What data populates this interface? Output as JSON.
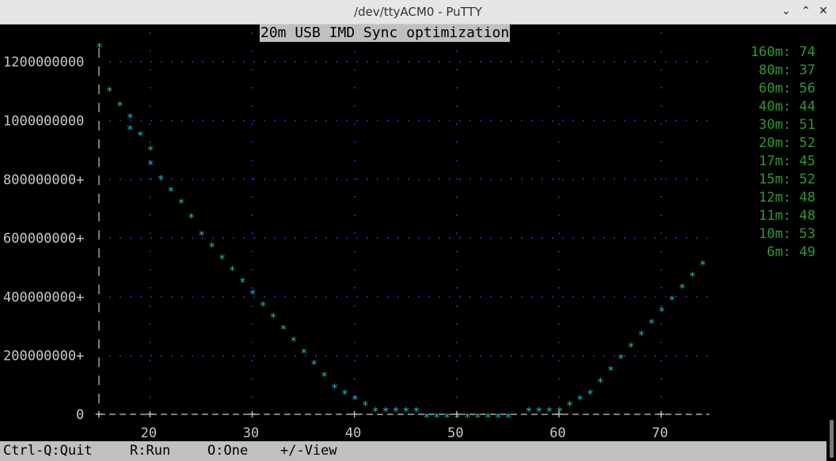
{
  "window": {
    "title": "/dev/ttyACM0 - PuTTY",
    "controls": {
      "minimize": "⌄",
      "maximize": "⌃",
      "close": "✕"
    }
  },
  "terminal": {
    "title": "20m USB IMD Sync optimization",
    "status": [
      {
        "key": "ctrl-q",
        "label": "Ctrl-Q:Quit"
      },
      {
        "key": "r",
        "label": "R:Run"
      },
      {
        "key": "o",
        "label": "O:One"
      },
      {
        "key": "plus-minus",
        "label": "+/-View"
      }
    ],
    "bands": [
      {
        "band": "160m",
        "text": "160m: 74"
      },
      {
        "band": "80m",
        "text": "80m: 37"
      },
      {
        "band": "60m",
        "text": "60m: 56"
      },
      {
        "band": "40m",
        "text": "40m: 44"
      },
      {
        "band": "30m",
        "text": "30m: 51"
      },
      {
        "band": "20m",
        "text": "20m: 52"
      },
      {
        "band": "17m",
        "text": "17m: 45"
      },
      {
        "band": "15m",
        "text": "15m: 52"
      },
      {
        "band": "12m",
        "text": "12m: 48"
      },
      {
        "band": "11m",
        "text": "11m: 48"
      },
      {
        "band": "10m",
        "text": "10m: 53"
      },
      {
        "band": "6m",
        "text": "6m: 49"
      }
    ]
  },
  "colors": {
    "points": "#27b3b3",
    "grid": "#1e2a9a",
    "bands": "#2e9a2e",
    "axis": "#c8c8c8",
    "title_bg": "#c0c0c0"
  },
  "chart_data": {
    "type": "scatter",
    "title": "20m USB IMD Sync optimization",
    "xlabel": "",
    "ylabel": "",
    "xlim": [
      15,
      75
    ],
    "ylim": [
      0,
      1300000000
    ],
    "x_ticks": [
      20,
      30,
      40,
      50,
      60,
      70
    ],
    "y_ticks": [
      0,
      200000000,
      400000000,
      600000000,
      800000000,
      1000000000,
      1200000000
    ],
    "y_tick_labels": [
      "0",
      "200000000+",
      "400000000+",
      "600000000+",
      "800000000+",
      "1000000000",
      "1200000000"
    ],
    "grid": true,
    "x": [
      15,
      16,
      17,
      18,
      18,
      19,
      20,
      20,
      21,
      22,
      23,
      24,
      25,
      26,
      27,
      28,
      29,
      30,
      31,
      32,
      33,
      34,
      35,
      36,
      37,
      38,
      39,
      40,
      41,
      42,
      43,
      44,
      45,
      46,
      47,
      48,
      49,
      50,
      51,
      52,
      53,
      54,
      55,
      57,
      58,
      59,
      60,
      61,
      62,
      63,
      64,
      65,
      66,
      67,
      68,
      69,
      70,
      71,
      72,
      73,
      74
    ],
    "y": [
      1260000000,
      1110000000,
      1060000000,
      1020000000,
      980000000,
      960000000,
      910000000,
      860000000,
      810000000,
      770000000,
      730000000,
      680000000,
      620000000,
      580000000,
      540000000,
      500000000,
      460000000,
      420000000,
      380000000,
      340000000,
      300000000,
      260000000,
      220000000,
      180000000,
      140000000,
      100000000,
      80000000,
      60000000,
      40000000,
      20000000,
      20000000,
      20000000,
      20000000,
      20000000,
      0,
      0,
      0,
      0,
      0,
      0,
      0,
      0,
      0,
      20000000,
      20000000,
      20000000,
      20000000,
      40000000,
      60000000,
      80000000,
      120000000,
      160000000,
      200000000,
      240000000,
      280000000,
      320000000,
      360000000,
      400000000,
      440000000,
      480000000,
      520000000
    ]
  }
}
